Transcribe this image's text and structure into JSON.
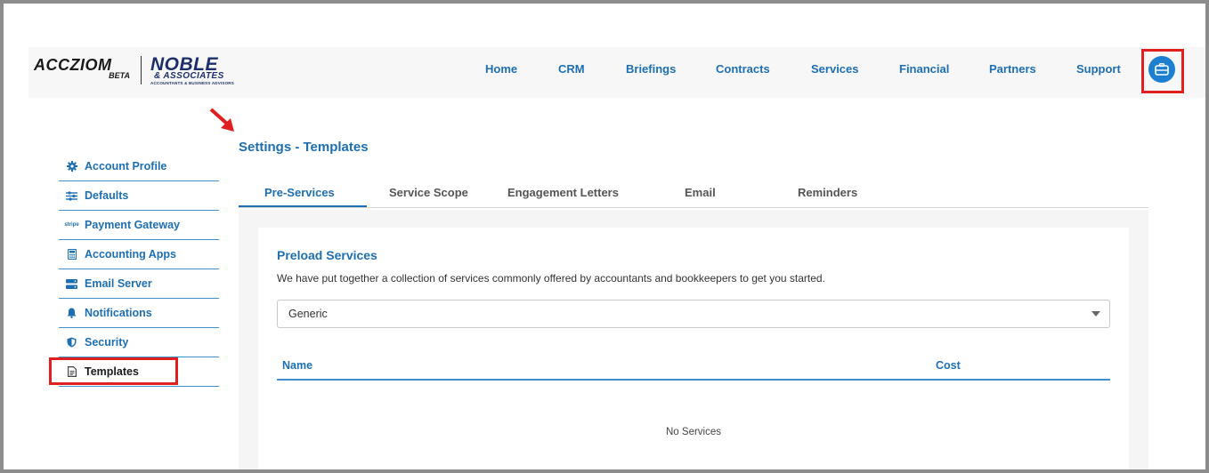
{
  "header": {
    "logo": {
      "brand": "ACCZIOM",
      "beta": "BETA",
      "partner": "NOBLE",
      "partner_sub": "& ASSOCIATES",
      "partner_tag": "ACCOUNTANTS & BUSINESS ADVISORS"
    },
    "nav": [
      "Home",
      "CRM",
      "Briefings",
      "Contracts",
      "Services",
      "Financial",
      "Partners",
      "Support"
    ],
    "app_icon": "briefcase-icon"
  },
  "page": {
    "title": "Settings - Templates"
  },
  "sidebar": {
    "items": [
      {
        "label": "Account Profile",
        "icon": "gear-icon"
      },
      {
        "label": "Defaults",
        "icon": "sliders-icon"
      },
      {
        "label": "Payment Gateway",
        "icon": "stripe-icon"
      },
      {
        "label": "Accounting Apps",
        "icon": "calculator-icon"
      },
      {
        "label": "Email Server",
        "icon": "server-icon"
      },
      {
        "label": "Notifications",
        "icon": "bell-icon"
      },
      {
        "label": "Security",
        "icon": "shield-icon"
      },
      {
        "label": "Templates",
        "icon": "document-icon"
      }
    ],
    "active": "Templates"
  },
  "tabs": {
    "items": [
      "Pre-Services",
      "Service Scope",
      "Engagement Letters",
      "Email",
      "Reminders"
    ],
    "active": "Pre-Services"
  },
  "preload": {
    "title": "Preload Services",
    "description": "We have put together a collection of services commonly offered by accountants and bookkeepers to get you started.",
    "select_value": "Generic",
    "columns": [
      "Name",
      "Cost"
    ],
    "empty_text": "No Services"
  },
  "colors": {
    "accent": "#1d6fb2",
    "highlight": "#e0201f",
    "app_button": "#1d7fcf"
  }
}
